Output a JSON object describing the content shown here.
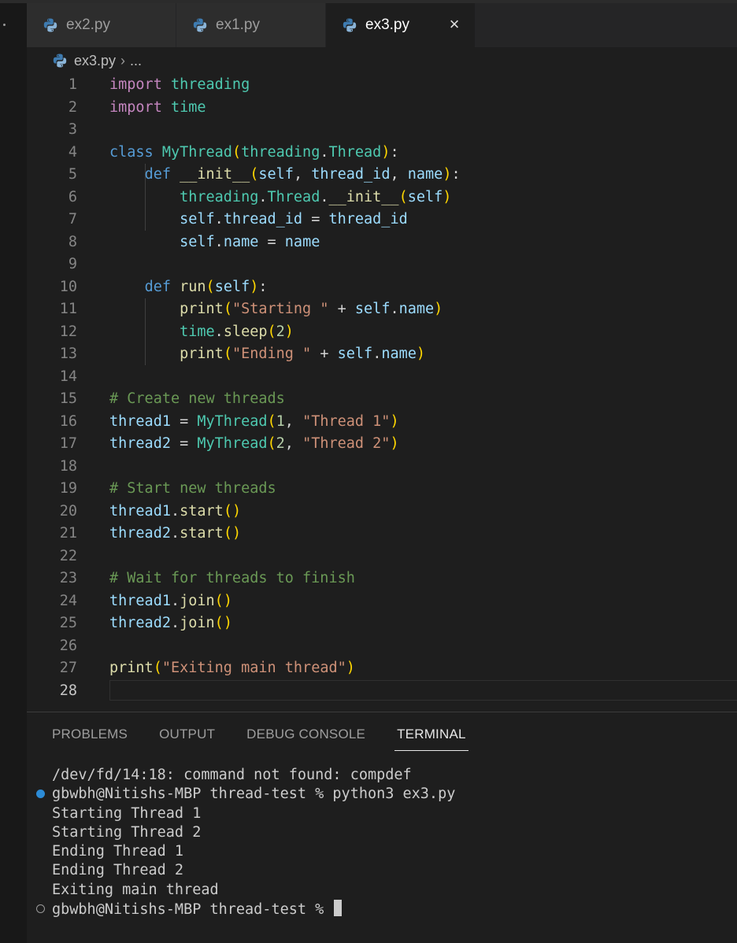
{
  "tabs": [
    {
      "label": "ex2.py",
      "active": false
    },
    {
      "label": "ex1.py",
      "active": false
    },
    {
      "label": "ex3.py",
      "active": true
    }
  ],
  "tab_close_glyph": "×",
  "breadcrumb": {
    "file": "ex3.py",
    "separator": "›",
    "more": "..."
  },
  "editor": {
    "current_line": 28,
    "line_numbers": [
      "1",
      "2",
      "3",
      "4",
      "5",
      "6",
      "7",
      "8",
      "9",
      "10",
      "11",
      "12",
      "13",
      "14",
      "15",
      "16",
      "17",
      "18",
      "19",
      "20",
      "21",
      "22",
      "23",
      "24",
      "25",
      "26",
      "27",
      "28"
    ],
    "lines": [
      "import threading",
      "import time",
      "",
      "class MyThread(threading.Thread):",
      "    def __init__(self, thread_id, name):",
      "        threading.Thread.__init__(self)",
      "        self.thread_id = thread_id",
      "        self.name = name",
      "",
      "    def run(self):",
      "        print(\"Starting \" + self.name)",
      "        time.sleep(2)",
      "        print(\"Ending \" + self.name)",
      "",
      "# Create new threads",
      "thread1 = MyThread(1, \"Thread 1\")",
      "thread2 = MyThread(2, \"Thread 2\")",
      "",
      "# Start new threads",
      "thread1.start()",
      "thread2.start()",
      "",
      "# Wait for threads to finish",
      "thread1.join()",
      "thread2.join()",
      "",
      "print(\"Exiting main thread\")",
      ""
    ]
  },
  "panel": {
    "tabs": [
      {
        "label": "PROBLEMS",
        "active": false
      },
      {
        "label": "OUTPUT",
        "active": false
      },
      {
        "label": "DEBUG CONSOLE",
        "active": false
      },
      {
        "label": "TERMINAL",
        "active": true
      }
    ],
    "terminal": {
      "lines": [
        "/dev/fd/14:18: command not found: compdef",
        "gbwbh@Nitishs-MBP thread-test % python3 ex3.py",
        "Starting Thread 1",
        "Starting Thread 2",
        "Ending Thread 1",
        "Ending Thread 2",
        "Exiting main thread",
        "gbwbh@Nitishs-MBP thread-test % "
      ]
    }
  },
  "colors": {
    "background": "#1e1e1e",
    "keyword": "#c586c0",
    "storage": "#569cd6",
    "class": "#4ec9b0",
    "function": "#dcdcaa",
    "variable": "#9cdcfe",
    "string": "#ce9178",
    "number": "#b5cea8",
    "comment": "#6a9955",
    "terminal_success_mark": "#2c8bd6"
  },
  "icons": {
    "tab": "python-file-icon",
    "close": "close-icon",
    "terminal_marks": [
      "command-success-mark-icon",
      "command-pending-mark-icon"
    ]
  }
}
